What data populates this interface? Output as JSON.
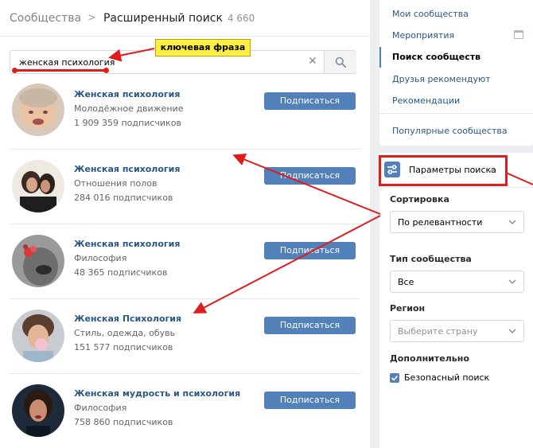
{
  "header": {
    "breadcrumb": "Сообщества",
    "separator": ">",
    "title": "Расширенный поиск",
    "count": "4 660"
  },
  "search": {
    "value": "женская психология",
    "clear_icon": "close-icon",
    "search_icon": "search-icon"
  },
  "annotation": {
    "label": "ключевая фраза",
    "color": "#e01d1d",
    "label_bg": "#ffef40"
  },
  "results": [
    {
      "name": "Женская психология",
      "desc": "Молодёжное движение",
      "subs": "1 909 359 подписчиков",
      "button": "Подписаться"
    },
    {
      "name": "Женская психология",
      "desc": "Отношения полов",
      "subs": "284 016 подписчиков",
      "button": "Подписаться"
    },
    {
      "name": "Женская психология",
      "desc": "Философия",
      "subs": "48 365 подписчиков",
      "button": "Подписаться"
    },
    {
      "name": "Женская Психология",
      "desc": "Стиль, одежда, обувь",
      "subs": "151 577 подписчиков",
      "button": "Подписаться"
    },
    {
      "name": "Женская мудрость и психология",
      "desc": "Философия",
      "subs": "758 860 подписчиков",
      "button": "Подписаться"
    }
  ],
  "nav": {
    "items": [
      {
        "label": "Мои сообщества"
      },
      {
        "label": "Мероприятия"
      },
      {
        "label": "Поиск сообществ"
      },
      {
        "label": "Друзья рекомендуют"
      },
      {
        "label": "Рекомендации"
      },
      {
        "label": "Популярные сообщества"
      }
    ],
    "active_index": 2
  },
  "params": {
    "title": "Параметры поиска",
    "sort_label": "Сортировка",
    "sort_value": "По релевантности",
    "type_label": "Тип сообщества",
    "type_value": "Все",
    "region_label": "Регион",
    "region_placeholder": "Выберите страну",
    "extra_label": "Дополнительно",
    "safe_search_label": "Безопасный поиск",
    "safe_search_checked": true
  },
  "colors": {
    "accent": "#5181b8",
    "link": "#2a5885",
    "background": "#edeef0"
  }
}
